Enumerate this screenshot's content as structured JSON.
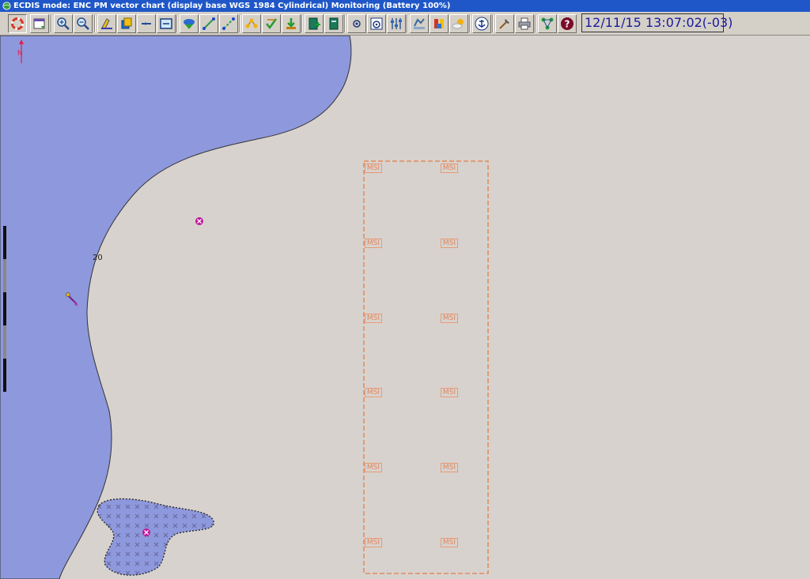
{
  "window": {
    "title": "ECDIS mode: ENC PM vector chart (display base  WGS 1984  Cylindrical)    Monitoring  (Battery 100%)"
  },
  "toolbar": {
    "buttons": [
      {
        "name": "lifebuoy-icon"
      },
      {
        "name": "calendar-icon"
      },
      {
        "name": "zoom-in-icon"
      },
      {
        "name": "zoom-out-icon"
      },
      {
        "name": "paint-icon"
      },
      {
        "name": "layers-icon"
      },
      {
        "name": "chart-symbol-icon"
      },
      {
        "name": "chart-frame-icon"
      },
      {
        "name": "ship-route-icon"
      },
      {
        "name": "route-edit-icon"
      },
      {
        "name": "route-line-icon"
      },
      {
        "name": "waypoints-icon"
      },
      {
        "name": "route-check-icon"
      },
      {
        "name": "route-import-icon"
      },
      {
        "name": "book-add-icon"
      },
      {
        "name": "book-icon"
      },
      {
        "name": "target-icon"
      },
      {
        "name": "radar-icon"
      },
      {
        "name": "sliders-icon"
      },
      {
        "name": "tide-icon"
      },
      {
        "name": "current-icon"
      },
      {
        "name": "weather-icon"
      },
      {
        "name": "anchor-icon"
      },
      {
        "name": "tools-icon"
      },
      {
        "name": "printer-icon"
      },
      {
        "name": "network-icon"
      },
      {
        "name": "help-icon"
      }
    ],
    "clock": "12/11/15 13:07:02(-03)"
  },
  "chart": {
    "north_label": "N",
    "depth_contour_label": "20",
    "msi_label": "MSI",
    "colors": {
      "land": "#d8d2ce",
      "water": "#8e98dc",
      "msi_area": "#e08a5c",
      "hazard": "#c0189a"
    }
  }
}
